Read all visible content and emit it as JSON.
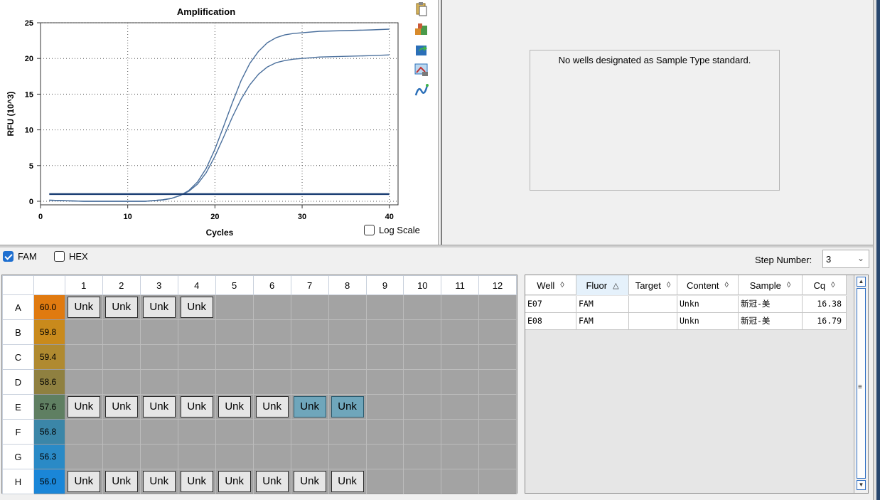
{
  "chart_data": {
    "type": "line",
    "title": "Amplification",
    "xlabel": "Cycles",
    "ylabel": "RFU (10^3)",
    "xlim": [
      0,
      41
    ],
    "ylim": [
      -0.5,
      25
    ],
    "xticks": [
      "0",
      "10",
      "20",
      "30",
      "40"
    ],
    "yticks": [
      "0",
      "5",
      "10",
      "15",
      "20",
      "25"
    ],
    "grid": true,
    "series": [
      {
        "x": [
          1,
          5,
          10,
          12,
          14,
          15,
          16,
          17,
          18,
          19,
          20,
          21,
          22,
          23,
          24,
          25,
          26,
          27,
          28,
          29,
          30,
          32,
          35,
          38,
          40
        ],
        "y": [
          0.15,
          0.0,
          0.0,
          0.0,
          0.2,
          0.4,
          0.8,
          1.5,
          2.7,
          4.6,
          7.3,
          10.5,
          13.8,
          16.9,
          19.3,
          21.0,
          22.2,
          22.9,
          23.3,
          23.5,
          23.6,
          23.8,
          23.9,
          24.0,
          24.1
        ]
      },
      {
        "x": [
          1,
          5,
          10,
          12,
          14,
          15,
          16,
          17,
          18,
          19,
          20,
          21,
          22,
          23,
          24,
          25,
          26,
          27,
          28,
          29,
          30,
          32,
          35,
          38,
          40
        ],
        "y": [
          0.15,
          0.0,
          0.0,
          0.0,
          0.2,
          0.4,
          0.8,
          1.4,
          2.4,
          4.0,
          6.3,
          9.0,
          11.8,
          14.3,
          16.3,
          17.8,
          18.8,
          19.4,
          19.7,
          19.9,
          20.0,
          20.2,
          20.3,
          20.4,
          20.5
        ]
      },
      {
        "x": [
          1,
          40
        ],
        "y": [
          1.0,
          1.0
        ],
        "threshold": true
      }
    ]
  },
  "chart": {
    "log_scale_label": "Log Scale",
    "toolbar_icons": [
      "copy-icon",
      "export-icon",
      "refresh-icon",
      "image-icon",
      "curve-icon"
    ]
  },
  "standard_curve": {
    "message": "No wells designated as Sample Type standard."
  },
  "fluors": [
    {
      "label": "FAM",
      "checked": true
    },
    {
      "label": "HEX",
      "checked": false
    }
  ],
  "step": {
    "label": "Step Number:",
    "value": "3"
  },
  "plate": {
    "columns": [
      "1",
      "2",
      "3",
      "4",
      "5",
      "6",
      "7",
      "8",
      "9",
      "10",
      "11",
      "12"
    ],
    "rows": [
      {
        "label": "A",
        "temp": "60.0",
        "color": "#e07a10",
        "wells": [
          "Unk",
          "Unk",
          "Unk",
          "Unk",
          "",
          "",
          "",
          "",
          "",
          "",
          "",
          ""
        ]
      },
      {
        "label": "B",
        "temp": "59.8",
        "color": "#c98a1c",
        "wells": [
          "",
          "",
          "",
          "",
          "",
          "",
          "",
          "",
          "",
          "",
          "",
          ""
        ]
      },
      {
        "label": "C",
        "temp": "59.4",
        "color": "#b08a30",
        "wells": [
          "",
          "",
          "",
          "",
          "",
          "",
          "",
          "",
          "",
          "",
          "",
          ""
        ]
      },
      {
        "label": "D",
        "temp": "58.6",
        "color": "#8f8040",
        "wells": [
          "",
          "",
          "",
          "",
          "",
          "",
          "",
          "",
          "",
          "",
          "",
          ""
        ]
      },
      {
        "label": "E",
        "temp": "57.6",
        "color": "#5f7f62",
        "wells": [
          "Unk",
          "Unk",
          "Unk",
          "Unk",
          "Unk",
          "Unk",
          "Unk",
          "Unk",
          "",
          "",
          "",
          ""
        ],
        "selected": [
          6,
          7
        ]
      },
      {
        "label": "F",
        "temp": "56.8",
        "color": "#3b86a8",
        "wells": [
          "",
          "",
          "",
          "",
          "",
          "",
          "",
          "",
          "",
          "",
          "",
          ""
        ]
      },
      {
        "label": "G",
        "temp": "56.3",
        "color": "#2a8ac6",
        "wells": [
          "",
          "",
          "",
          "",
          "",
          "",
          "",
          "",
          "",
          "",
          "",
          ""
        ]
      },
      {
        "label": "H",
        "temp": "56.0",
        "color": "#1a86d8",
        "wells": [
          "Unk",
          "Unk",
          "Unk",
          "Unk",
          "Unk",
          "Unk",
          "Unk",
          "Unk",
          "",
          "",
          "",
          ""
        ]
      }
    ]
  },
  "results": {
    "columns": [
      {
        "label": "Well",
        "sort": "◊"
      },
      {
        "label": "Fluor",
        "sort": "△"
      },
      {
        "label": "Target",
        "sort": "◊"
      },
      {
        "label": "Content",
        "sort": "◊"
      },
      {
        "label": "Sample",
        "sort": "◊"
      },
      {
        "label": "Cq",
        "sort": "◊"
      }
    ],
    "rows": [
      [
        "E07",
        "FAM",
        "",
        "Unkn",
        "新冠-美",
        "16.38"
      ],
      [
        "E08",
        "FAM",
        "",
        "Unkn",
        "新冠-美",
        "16.79"
      ]
    ]
  },
  "colors": {
    "curve": "#4a6f9c",
    "threshold": "#1c3f74",
    "selected_well": "#6fa6bb"
  }
}
